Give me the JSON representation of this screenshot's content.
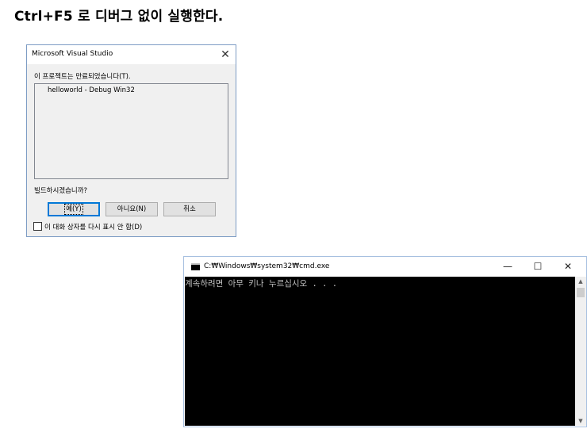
{
  "heading": "Ctrl+F5 로 디버그 없이 실행한다.",
  "vs_dialog": {
    "title": "Microsoft Visual Studio",
    "close_glyph": "✕",
    "question": "이 프로젝트는 만료되었습니다(T).",
    "list_items": [
      "helloworld - Debug Win32"
    ],
    "prompt": "빌드하시겠습니까?",
    "buttons": {
      "yes": "예(Y)",
      "no": "아니요(N)",
      "cancel": "취소"
    },
    "checkbox_label": "이 대화 상자를 다시 표시 안 함(D)",
    "checkbox_checked": false,
    "accent_color": "#0078d7"
  },
  "console": {
    "title": "C:₩Windows₩system32₩cmd.exe",
    "minimize_glyph": "—",
    "maximize_glyph": "☐",
    "close_glyph": "✕",
    "output": "계속하려면 아무 키나 누르십시오 . . .",
    "scroll_up_glyph": "▲",
    "scroll_down_glyph": "▼",
    "background_color": "#000000",
    "text_color": "#c0c0c0"
  }
}
